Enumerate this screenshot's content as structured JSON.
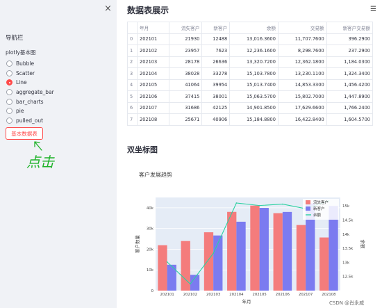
{
  "sidebar": {
    "close_symbol": "×",
    "nav_title": "导航栏",
    "radio_label": "plotly基本图",
    "options": [
      "Bubble",
      "Scatter",
      "Line",
      "aggregate_bar",
      "bar_charts",
      "pie",
      "pulled_out"
    ],
    "selected_option": "Line",
    "button_label": "基本数据表",
    "annotation": "点击",
    "annotation_color": "#1fb32a"
  },
  "header": {
    "title": "数据表展示",
    "menu_icon": "hamburger-icon"
  },
  "table": {
    "columns": [
      "",
      "年月",
      "流失客户",
      "新客户",
      "余额",
      "交易额",
      "新客户交易额"
    ],
    "rows": [
      [
        "0",
        "202101",
        "21930",
        "12488",
        "13,016.3600",
        "11,707.7600",
        "396.2900"
      ],
      [
        "1",
        "202102",
        "23957",
        "7623",
        "12,236.1600",
        "8,298.7600",
        "237.2900"
      ],
      [
        "2",
        "202103",
        "28178",
        "26636",
        "13,320.7200",
        "12,362.1800",
        "1,184.0300"
      ],
      [
        "3",
        "202104",
        "38028",
        "33278",
        "15,103.7800",
        "13,230.1100",
        "1,324.3400"
      ],
      [
        "4",
        "202105",
        "41064",
        "39954",
        "15,013.7400",
        "14,853.3300",
        "1,456.4200"
      ],
      [
        "5",
        "202106",
        "37415",
        "38001",
        "15,063.5700",
        "15,802.7000",
        "1,447.8900"
      ],
      [
        "6",
        "202107",
        "31686",
        "42125",
        "14,901.8500",
        "17,629.6600",
        "1,766.2400"
      ],
      [
        "7",
        "202108",
        "25671",
        "40906",
        "15,184.8800",
        "16,422.8400",
        "1,604.5700"
      ]
    ]
  },
  "section": {
    "title": "双坐标图"
  },
  "chart_data": {
    "type": "bar",
    "title": "客户发展趋势",
    "xlabel": "年月",
    "ylabel": "客户数量",
    "y2label": "余额",
    "categories": [
      "202101",
      "202102",
      "202103",
      "202104",
      "202105",
      "202106",
      "202107",
      "202108"
    ],
    "series": [
      {
        "name": "流失客户",
        "type": "bar",
        "axis": "left",
        "color": "#f47c7c",
        "values": [
          21930,
          23957,
          28178,
          38028,
          41064,
          37415,
          31686,
          25671
        ]
      },
      {
        "name": "新客户",
        "type": "bar",
        "axis": "left",
        "color": "#7b7bf0",
        "values": [
          12488,
          7623,
          26636,
          33278,
          39954,
          38001,
          42125,
          40906
        ]
      },
      {
        "name": "余额",
        "type": "line",
        "axis": "right",
        "color": "#2bd1a1",
        "values": [
          13016.36,
          12236.16,
          13320.72,
          15103.78,
          15013.74,
          15063.57,
          14901.85,
          15184.88
        ]
      }
    ],
    "ylim": [
      0,
      45000
    ],
    "yticks": [
      0,
      10000,
      20000,
      30000,
      40000
    ],
    "ytick_labels": [
      "0",
      "10k",
      "20k",
      "30k",
      "40k"
    ],
    "y2lim": [
      12000,
      15300
    ],
    "y2ticks": [
      12500,
      13000,
      13500,
      14000,
      14500,
      15000
    ],
    "y2tick_labels": [
      "12.5k",
      "13k",
      "13.5k",
      "14k",
      "14.5k",
      "15k"
    ],
    "legend_position": "top-right",
    "grid": true,
    "plot_bg": "#e5ecf6"
  },
  "watermark": "CSDN @肖永威"
}
